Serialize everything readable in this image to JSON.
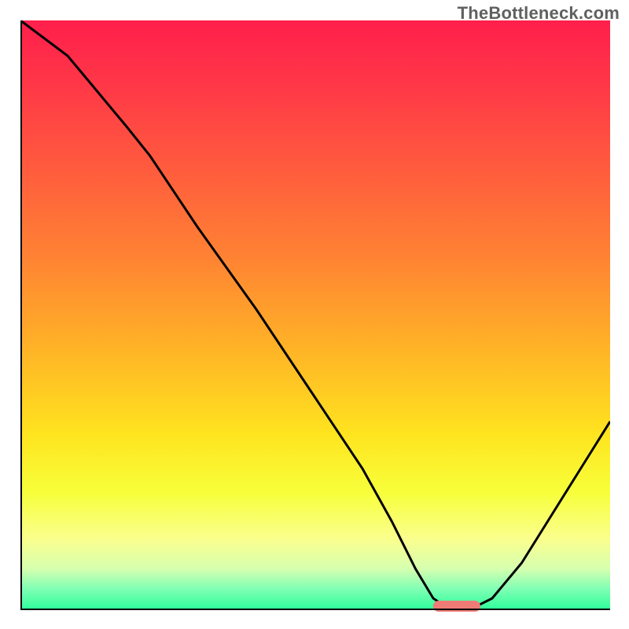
{
  "watermark": "TheBottleneck.com",
  "chart_data": {
    "type": "line",
    "title": "",
    "xlabel": "",
    "ylabel": "",
    "xlim": [
      0,
      100
    ],
    "ylim": [
      0,
      100
    ],
    "grid": false,
    "legend": false,
    "series": [
      {
        "name": "bottleneck-curve",
        "x": [
          0,
          8,
          18,
          22,
          30,
          40,
          50,
          58,
          63,
          67,
          70,
          73,
          76,
          80,
          85,
          90,
          95,
          100
        ],
        "values": [
          100,
          94,
          82,
          77,
          65,
          51,
          36,
          24,
          15,
          7,
          2,
          0,
          0,
          2,
          8,
          16,
          24,
          32
        ]
      }
    ],
    "gradient_stops": [
      {
        "offset": 0.0,
        "color": "#ff1f4b"
      },
      {
        "offset": 0.1,
        "color": "#ff3548"
      },
      {
        "offset": 0.25,
        "color": "#ff5b3e"
      },
      {
        "offset": 0.4,
        "color": "#ff8233"
      },
      {
        "offset": 0.55,
        "color": "#ffb127"
      },
      {
        "offset": 0.7,
        "color": "#ffe31f"
      },
      {
        "offset": 0.8,
        "color": "#f7ff3a"
      },
      {
        "offset": 0.88,
        "color": "#faff8e"
      },
      {
        "offset": 0.93,
        "color": "#d6ffb0"
      },
      {
        "offset": 0.965,
        "color": "#7dffb4"
      },
      {
        "offset": 1.0,
        "color": "#2cff9a"
      }
    ],
    "marker": {
      "name": "optimal-zone",
      "x_start": 70,
      "x_end": 78,
      "color": "#ef7b77"
    }
  }
}
